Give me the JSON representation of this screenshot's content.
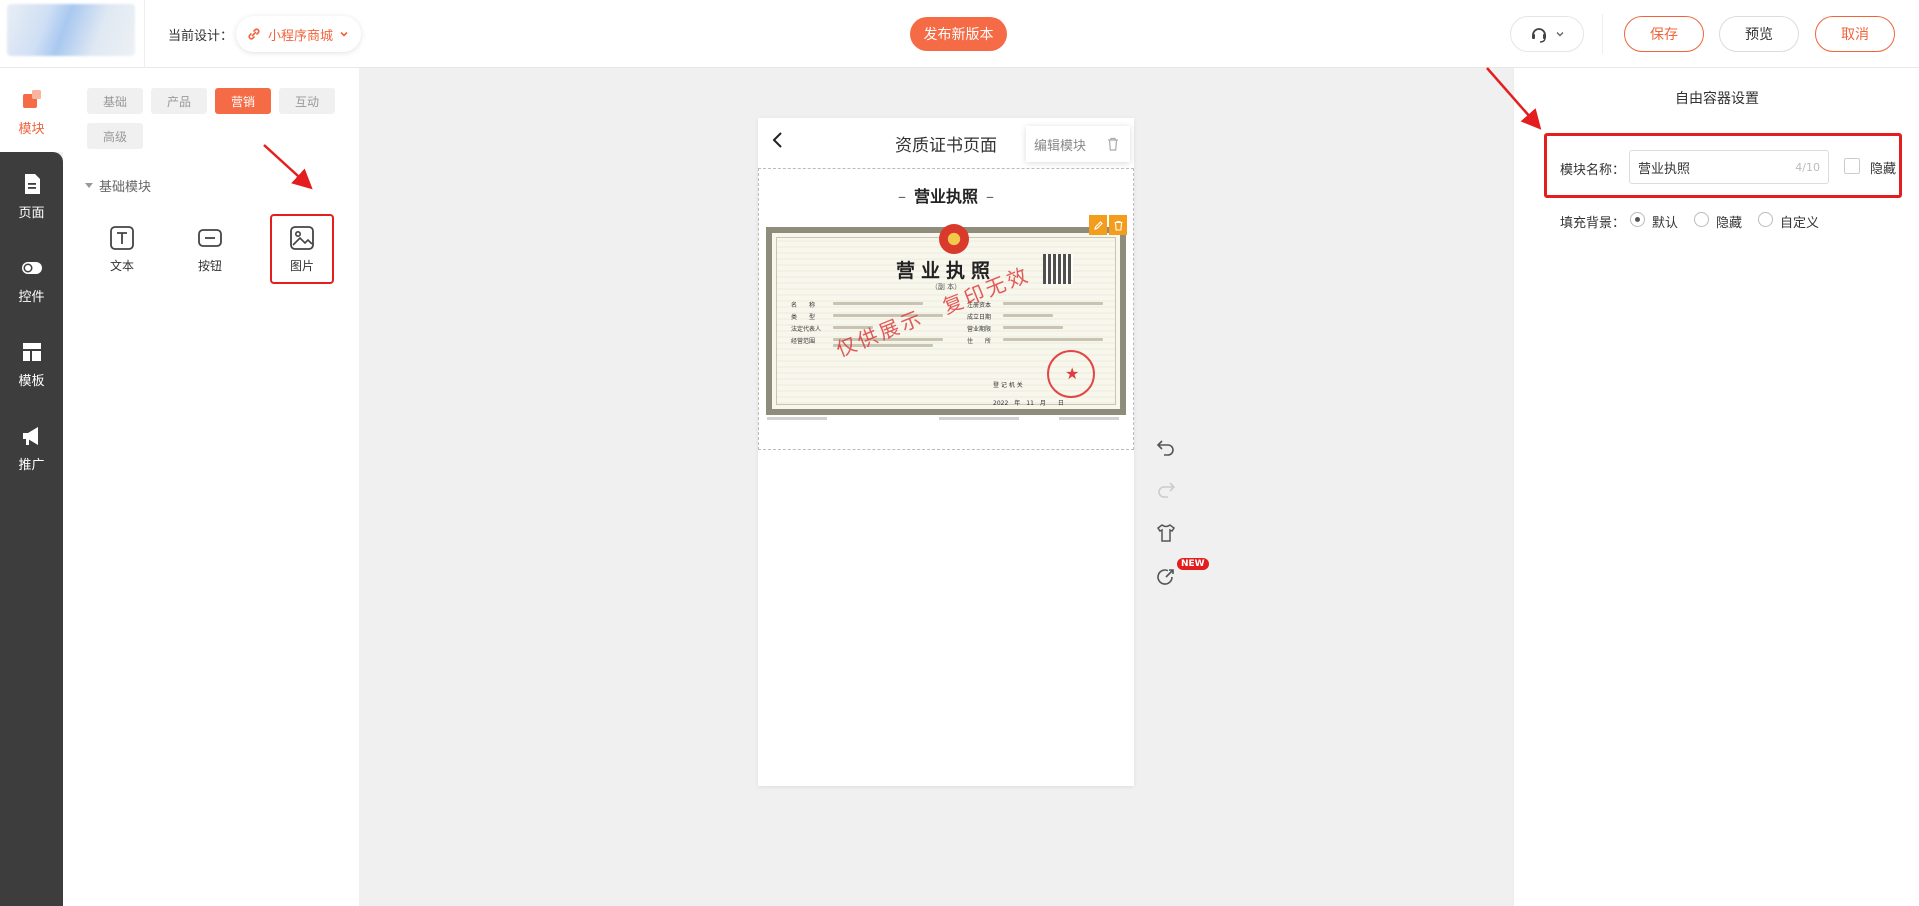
{
  "header": {
    "current_label": "当前设计：",
    "design_name": "小程序商城",
    "publish": "发布新版本",
    "save": "保存",
    "preview": "预览",
    "cancel": "取消"
  },
  "rail": {
    "items": [
      {
        "label": "模块"
      },
      {
        "label": "页面"
      },
      {
        "label": "控件"
      },
      {
        "label": "模板"
      },
      {
        "label": "推广"
      }
    ]
  },
  "panel": {
    "tabs": [
      "基础",
      "产品",
      "营销",
      "互动",
      "高级"
    ],
    "group": "基础模块",
    "modules": [
      "文本",
      "按钮",
      "图片"
    ]
  },
  "canvas": {
    "page_title": "资质证书页面",
    "edit_module": "编辑模块",
    "section_title": "营业执照",
    "license": {
      "title": "营业执照",
      "sub": "（副 本）",
      "labels": [
        "名　　称",
        "类　　型",
        "法定代表人",
        "经营范围"
      ],
      "right_labels": [
        "注册资本",
        "成立日期",
        "营业期限",
        "住　　所"
      ],
      "watermark": "仅供展示　复印无效",
      "register_label": "登 记 机 关",
      "date": "2022　年　11　月　　日"
    },
    "new_badge": "NEW"
  },
  "right": {
    "title": "自由容器设置",
    "module_name_label": "模块名称：",
    "module_name_value": "营业执照",
    "module_name_count": "4/10",
    "hide_label": "隐藏",
    "fill_bg_label": "填充背景：",
    "fill_options": [
      "默认",
      "隐藏",
      "自定义"
    ]
  },
  "colors": {
    "accent": "#f46b45",
    "annotation": "#e41e1e",
    "rail_bg": "#3d3d3d"
  }
}
